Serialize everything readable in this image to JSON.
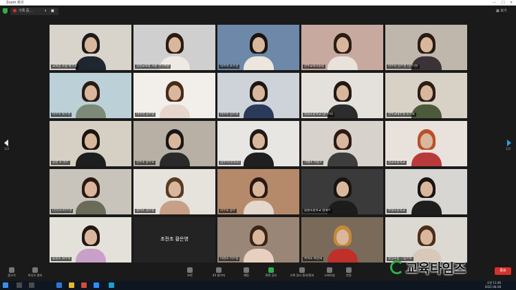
{
  "window": {
    "title": "Zoom 회의",
    "view_label": "보기"
  },
  "recording": {
    "label": "기록 중...",
    "pause": "⏸",
    "stop": "■"
  },
  "pager": {
    "left": "1/2",
    "right": "1/2"
  },
  "tiles": [
    {
      "label": "교육장 조정 박ㅇ호",
      "bg": "#d8d4cc",
      "shirt": "#1f2630",
      "hair": "#1b1b1b"
    },
    {
      "label": "김천교육청 지원 연구위원",
      "bg": "#cfcfcf",
      "shirt": "#efe9e3",
      "hair": "#2a1a12"
    },
    {
      "label": "이ㅇ아 조ㅇ선",
      "bg": "#6d88a8",
      "shirt": "#ece6dc",
      "hair": "#1a1410"
    },
    {
      "label": "전주교육지원청",
      "bg": "#c8a9a0",
      "shirt": "#e8e2da",
      "hair": "#2b1c14"
    },
    {
      "label": "이ㅇ자 김ㅇ경 (김ㅇ연)",
      "bg": "#bfb7ac",
      "shirt": "#3b3338",
      "hair": "#2a1a12"
    },
    {
      "label": "이ㅇ이 박ㅇ경",
      "bg": "#bcd0d8",
      "shirt": "#7d8a78",
      "hair": "#2a1a12"
    },
    {
      "label": "이ㅇ아 강ㅇ영",
      "bg": "#f2eeea",
      "shirt": "#e6d6cc",
      "hair": "#4a2a1a"
    },
    {
      "label": "이ㅇ우 김ㅇ희",
      "bg": "#cdd3d8",
      "shirt": "#2b3a5a",
      "hair": "#1e1612"
    },
    {
      "label": "영광초등학교 (윤ㅇ미)",
      "bg": "#e4e0dc",
      "shirt": "#2c2c2c",
      "hair": "#241812"
    },
    {
      "label": "전주교대부설 조ㅇ희",
      "bg": "#d8d2c6",
      "shirt": "#4a5a3a",
      "hair": "#2b1c14"
    },
    {
      "label": "김천 초 이ㅇ",
      "bg": "#d6cfc4",
      "shirt": "#1e1e1e",
      "hair": "#1b1411"
    },
    {
      "label": "진주초 윤ㅇ호",
      "bg": "#b8b0a4",
      "shirt": "#2a2a2a",
      "hair": "#171717"
    },
    {
      "label": "김주ㅇ(우리초)",
      "bg": "#e8e6e2",
      "shirt": "#1f1f1f",
      "hair": "#241812"
    },
    {
      "label": "가평초 이정ㅇ",
      "bg": "#d7d2cc",
      "shirt": "#3d3d3d",
      "hair": "#2a1a12"
    },
    {
      "label": "관교초등학교",
      "bg": "#e9e1dc",
      "shirt": "#b83a3a",
      "hair": "#b8502a"
    },
    {
      "label": "(전진초)이ㅇ경",
      "bg": "#c8c4bc",
      "shirt": "#6b6b5a",
      "hair": "#2a1a12"
    },
    {
      "label": "정어초 정ㅇ정",
      "bg": "#e6e2dc",
      "shirt": "#c8a088",
      "hair": "#5a3a22"
    },
    {
      "label": "지ㅇ초 강ㅇ",
      "bg": "#b48a6a",
      "shirt": "#e4d8cc",
      "hair": "#2a1a12"
    },
    {
      "label": "봉원초등학교 정해ㅇ",
      "bg": "#3a3a3a",
      "shirt": "#1c1c1c",
      "hair": "#1a1410"
    },
    {
      "label": "수영초등학교",
      "bg": "#d8d6d2",
      "shirt": "#1e1e1e",
      "hair": "#1a1410"
    },
    {
      "label": "동천초 최ㅇ숙",
      "bg": "#e4e0da",
      "shirt": "#c9a0c8",
      "hair": "#221711"
    },
    {
      "label": "",
      "noVideo": true,
      "center": "초전초 황은영"
    },
    {
      "label": "이천초 이ㅇ정",
      "bg": "#9a8676",
      "shirt": "#e8d0c0",
      "hair": "#3a2616"
    },
    {
      "label": "흑석초 박선희",
      "bg": "#7a6a5a",
      "shirt": "#c0302a",
      "hair": "#c48a3a"
    },
    {
      "label": "중앙초등 ㅡ임ㅇ미",
      "bg": "#dcd8d2",
      "shirt": "#d8c8b8",
      "hair": "#4a2e1a"
    }
  ],
  "toolbar": {
    "mute": "음소거",
    "video": "비디오 중지",
    "security": "보안",
    "participants": "참가자",
    "participants_count": "43",
    "chat": "채팅",
    "share": "화면 공유",
    "record": "기록 일시 중지/중지",
    "breakout": "소회의실",
    "reactions": "반응",
    "end": "종료"
  },
  "logo": {
    "text": "교육타임즈"
  },
  "clock": {
    "time": "오전 11:46",
    "date": "2021-04-28"
  }
}
